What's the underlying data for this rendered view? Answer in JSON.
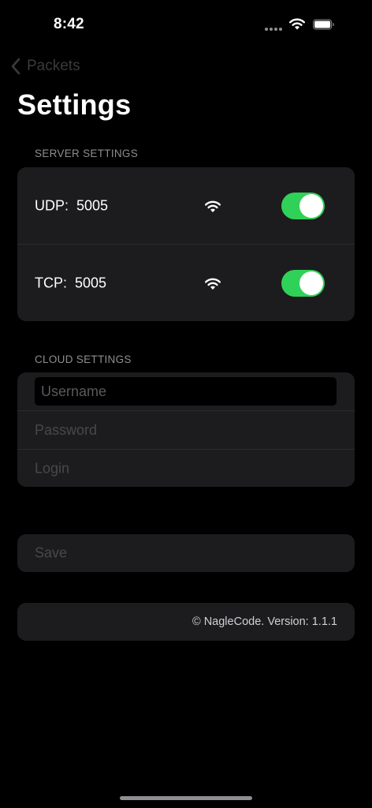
{
  "status_bar": {
    "time": "8:42"
  },
  "nav": {
    "back_label": "Packets"
  },
  "page": {
    "title": "Settings"
  },
  "server_settings": {
    "header": "SERVER SETTINGS",
    "rows": [
      {
        "label": "UDP:  5005",
        "enabled": true
      },
      {
        "label": "TCP:  5005",
        "enabled": true
      }
    ]
  },
  "cloud_settings": {
    "header": "CLOUD SETTINGS",
    "username_placeholder": "Username",
    "password_placeholder": "Password",
    "login_label": "Login"
  },
  "actions": {
    "save_label": "Save"
  },
  "footer": {
    "text": "© NagleCode. Version: 1.1.1"
  },
  "colors": {
    "background": "#000000",
    "card": "#1c1c1e",
    "toggle_on": "#30d158",
    "section_header": "#8e8e93",
    "disabled_text": "#48484a"
  },
  "icons": {
    "status_wifi": "wifi-icon",
    "battery": "battery-icon",
    "back": "chevron-left-icon",
    "row_wifi": "wifi-icon"
  }
}
